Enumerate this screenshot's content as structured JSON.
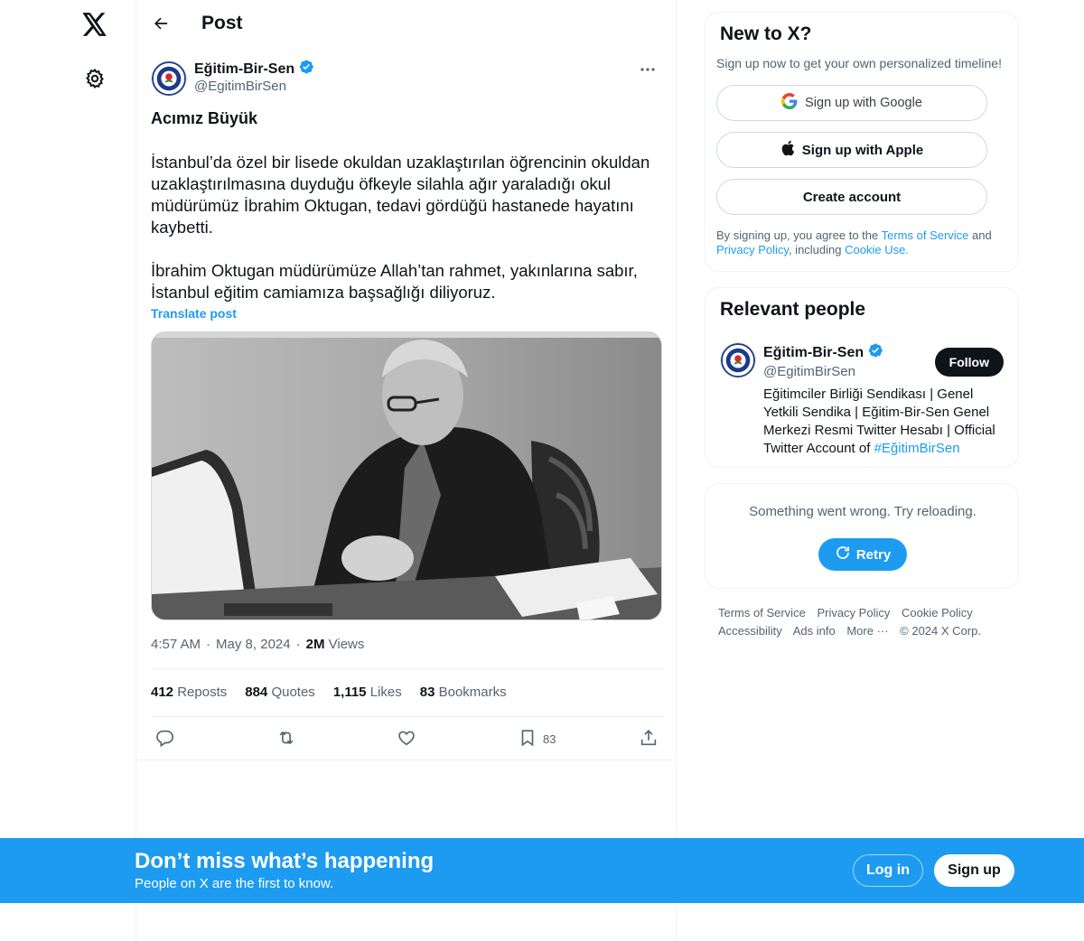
{
  "header": {
    "title": "Post"
  },
  "post": {
    "author_name": "Eğitim-Bir-Sen",
    "author_handle": "@EgitimBirSen",
    "title": "Acımız Büyük",
    "paragraphs": [
      "İstanbul’da özel bir lisede okuldan uzaklaştırılan öğrencinin okuldan uzaklaştırılmasına duyduğu öfkeyle silahla ağır yaraladığı okul müdürümüz İbrahim Oktugan, tedavi gördüğü hastanede hayatını kaybetti.",
      "İbrahim Oktugan müdürümüze Allah’tan rahmet, yakınlarına sabır, İstanbul eğitim camiamıza başsağlığı diliyoruz."
    ],
    "translate_label": "Translate post",
    "time": "4:57 AM",
    "date": "May 8, 2024",
    "views_count": "2M",
    "views_label": "Views",
    "stats": {
      "reposts_count": "412",
      "reposts_label": "Reposts",
      "quotes_count": "884",
      "quotes_label": "Quotes",
      "likes_count": "1,115",
      "likes_label": "Likes",
      "bookmarks_count": "83",
      "bookmarks_label": "Bookmarks"
    },
    "actions": {
      "bookmark_count": "83"
    }
  },
  "signup": {
    "title": "New to X?",
    "subtitle": "Sign up now to get your own personalized timeline!",
    "google_label": "Sign up with Google",
    "apple_label": "Sign up with Apple",
    "create_label": "Create account",
    "legal_prefix": "By signing up, you agree to the ",
    "terms": "Terms of Service",
    "and": " and ",
    "privacy": "Privacy Policy",
    "including": ", including ",
    "cookie": "Cookie Use."
  },
  "relevant": {
    "title": "Relevant people",
    "name": "Eğitim-Bir-Sen",
    "handle": "@EgitimBirSen",
    "follow_label": "Follow",
    "bio": "Eğitimciler Birliği Sendikası | Genel Yetkili Sendika | Eğitim-Bir-Sen Genel Merkezi Resmi Twitter Hesabı | Official Twitter Account of ",
    "bio_hashtag": "#EğitimBirSen"
  },
  "error_card": {
    "message": "Something went wrong. Try reloading.",
    "retry_label": "Retry"
  },
  "footer": {
    "links": [
      "Terms of Service",
      "Privacy Policy",
      "Cookie Policy",
      "Accessibility",
      "Ads info",
      "More ···",
      "© 2024 X Corp."
    ]
  },
  "banner": {
    "title": "Don’t miss what’s happening",
    "subtitle": "People on X are the first to know.",
    "login_label": "Log in",
    "signup_label": "Sign up"
  },
  "colors": {
    "accent": "#1d9bf0",
    "text": "#0f1419",
    "muted": "#536471",
    "border": "#eff3f4"
  },
  "icons": [
    "x-logo-icon",
    "gear-icon",
    "back-arrow-icon",
    "verified-icon",
    "more-icon",
    "reply-icon",
    "repost-icon",
    "like-icon",
    "bookmark-icon",
    "share-icon",
    "google-icon",
    "apple-icon",
    "refresh-icon"
  ]
}
